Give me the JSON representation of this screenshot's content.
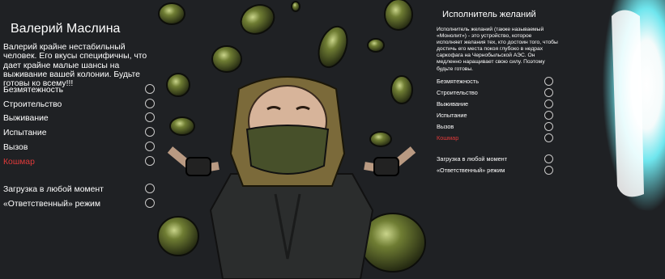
{
  "left_panel": {
    "title": "Валерий Маслина",
    "description": "Валерий крайне нестабильный человек. Его вкусы специфичны, что дает крайне малые шансы на выживание вашей колонии. Будьте готовы ко всему!!!",
    "difficulties": [
      "Безмятежность",
      "Строительство",
      "Выживание",
      "Испытание",
      "Вызов",
      "Кошмар"
    ],
    "modes": [
      "Загрузка в любой момент",
      "«Ответственный» режим"
    ]
  },
  "right_panel": {
    "title": "Исполнитель желаний",
    "description": "Исполнитель желаний (также называемый «Монолит») - это устройство, которое исполняет желания тех, кто достоин того, чтобы достичь его места покоя глубоко в недрах саркофага на Чернобыльской АЭС. Он медленно наращивает свою силу. Поэтому будьте готовы.",
    "difficulties": [
      "Безмятежность",
      "Строительство",
      "Выживание",
      "Испытание",
      "Вызов",
      "Кошмар"
    ],
    "modes": [
      "Загрузка в любой момент",
      "«Ответственный» режим"
    ]
  },
  "colors": {
    "background": "#1f2124",
    "text": "#ffffff",
    "danger": "#e03a3a",
    "radio_border": "#c9c9c9",
    "olive": "#5c6b2c",
    "glow": "#6fe6ee"
  }
}
